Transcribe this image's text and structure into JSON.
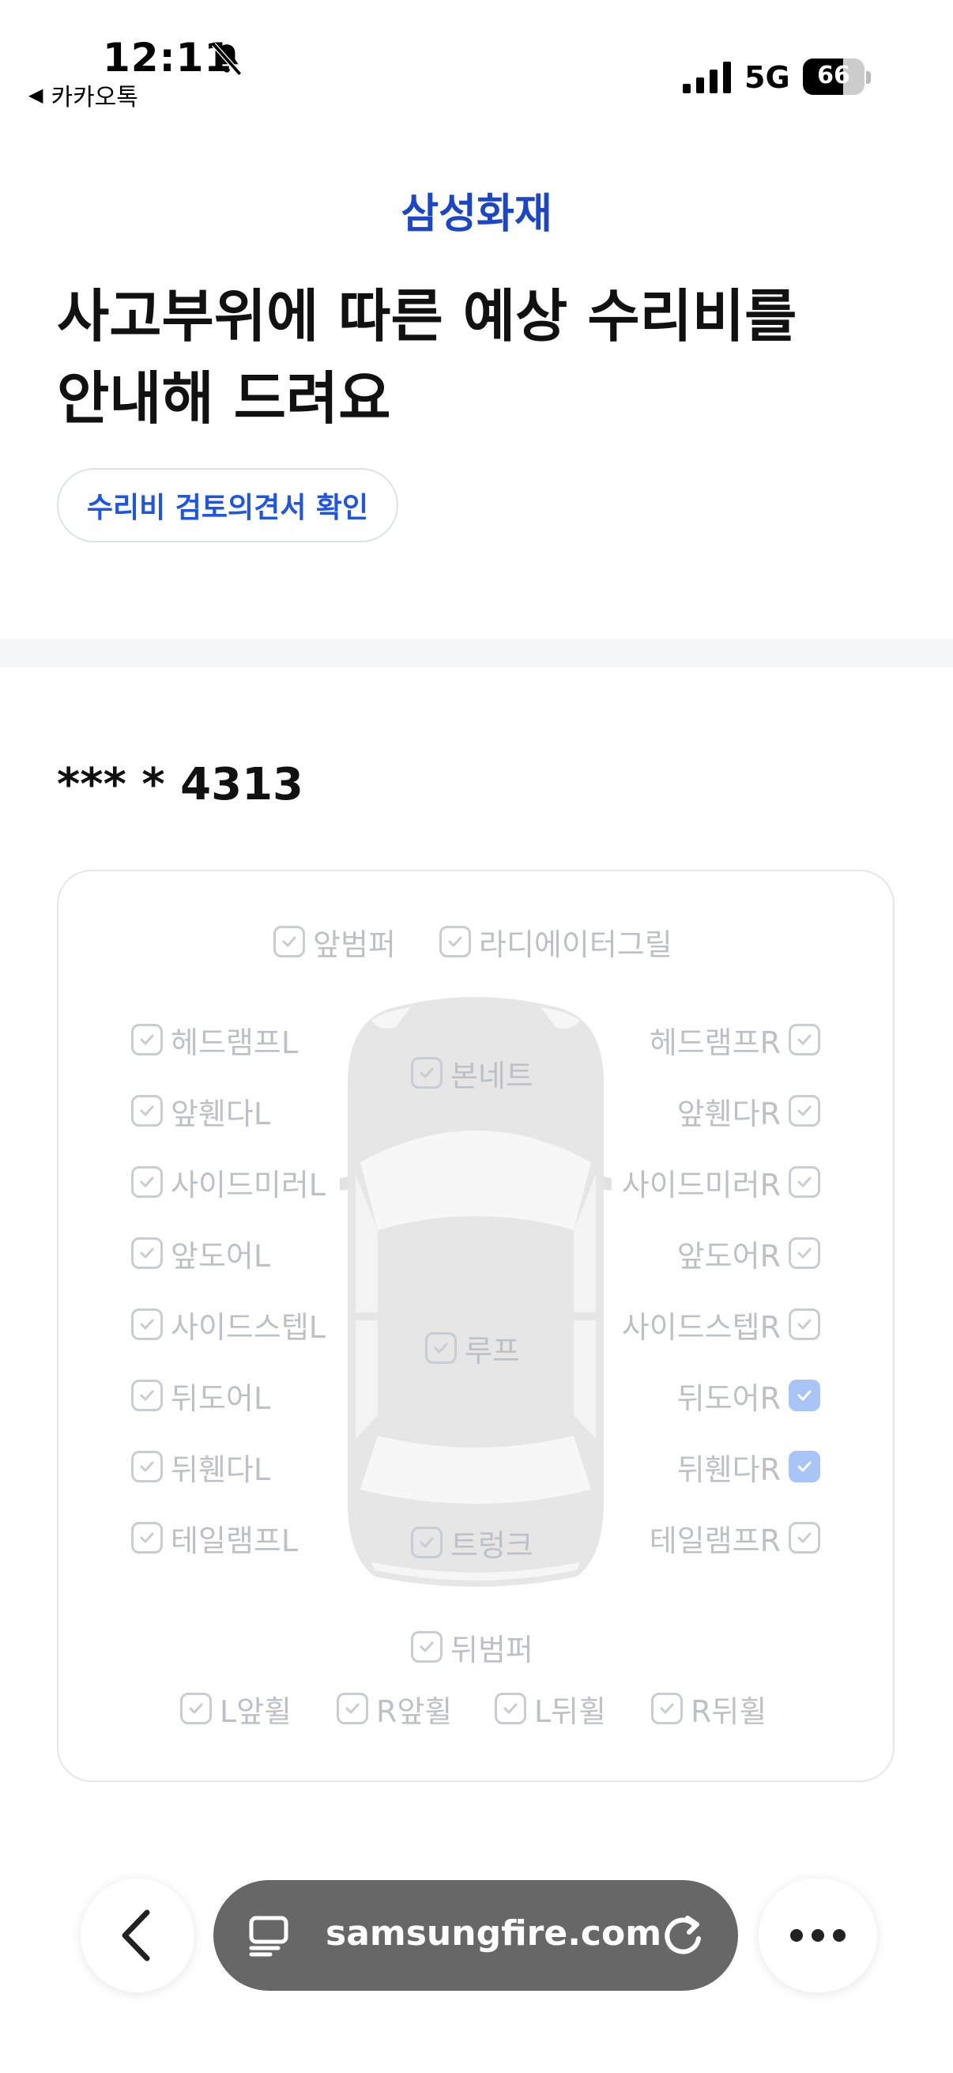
{
  "status_bar": {
    "time": "12:11",
    "back_app": "카카오톡",
    "network": "5G",
    "battery": "66",
    "battery_level": 0.66
  },
  "header": {
    "brand": "삼성화재",
    "headline_line1": "사고부위에 따른 예상 수리비를",
    "headline_line2": "안내해 드려요",
    "review_button": "수리비 검토의견서 확인"
  },
  "vehicle": {
    "plate": "*** * 4313"
  },
  "damage_parts": {
    "front_bumper": "앞범퍼",
    "radiator_grille": "라디에이터그릴",
    "headlamp_l": "헤드램프L",
    "headlamp_r": "헤드램프R",
    "hood": "본네트",
    "front_fender_l": "앞휀다L",
    "front_fender_r": "앞휀다R",
    "side_mirror_l": "사이드미러L",
    "side_mirror_r": "사이드미러R",
    "front_door_l": "앞도어L",
    "front_door_r": "앞도어R",
    "side_step_l": "사이드스텝L",
    "side_step_r": "사이드스텝R",
    "roof": "루프",
    "rear_door_l": "뒤도어L",
    "rear_door_r": "뒤도어R",
    "rear_fender_l": "뒤휀다L",
    "rear_fender_r": "뒤휀다R",
    "taillamp_l": "테일램프L",
    "taillamp_r": "테일램프R",
    "trunk": "트렁크",
    "rear_bumper": "뒤범퍼",
    "wheel_fl": "L앞휠",
    "wheel_fr": "R앞휠",
    "wheel_rl": "L뒤휠",
    "wheel_rr": "R뒤휠",
    "selected": [
      "뒤도어R",
      "뒤휀다R"
    ]
  },
  "browser": {
    "url": "samsungfire.com",
    "icons": [
      "back-icon",
      "reader-icon",
      "reload-icon",
      "more-icon"
    ]
  },
  "colors": {
    "brand": "#1c46c8",
    "link": "#1f55e6",
    "checked": "#a9c4f7",
    "muted": "#bdc1c7"
  }
}
